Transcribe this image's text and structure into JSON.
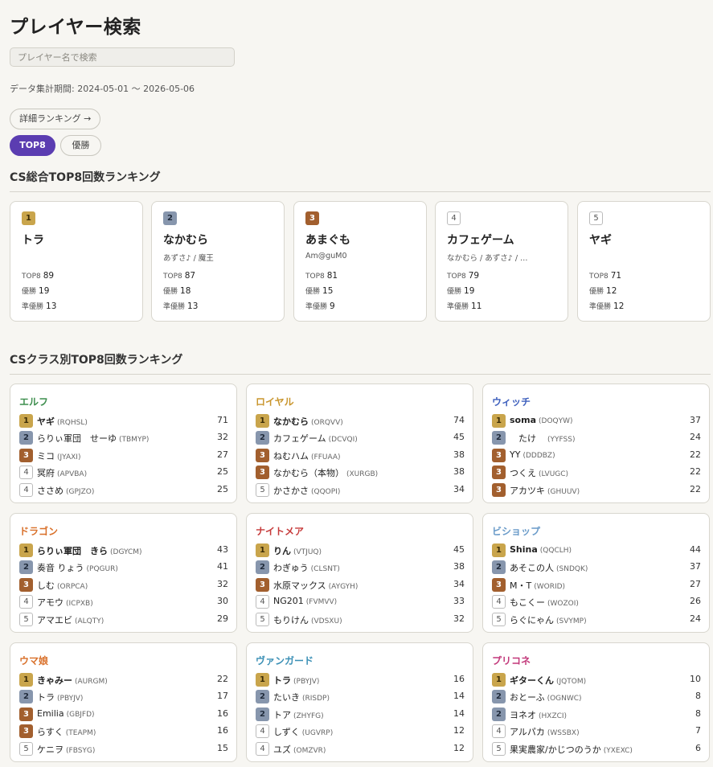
{
  "page": {
    "title": "プレイヤー検索",
    "search_placeholder": "プレイヤー名で検索",
    "period": "データ集計期間: 2024-05-01 〜 2026-05-06",
    "detail_button": "詳細ランキング →",
    "tabs": [
      "TOP8",
      "優勝"
    ]
  },
  "overall": {
    "title": "CS総合TOP8回数ランキング",
    "labels": {
      "top8": "TOP8",
      "win": "優勝",
      "runner": "準優勝"
    },
    "cards": [
      {
        "rank": "1",
        "name": "トラ",
        "sub": "",
        "top8": "89",
        "win": "19",
        "runner": "13"
      },
      {
        "rank": "2",
        "name": "なかむら",
        "sub": "あずさ♪ / 魔王",
        "top8": "87",
        "win": "18",
        "runner": "13"
      },
      {
        "rank": "3",
        "name": "あまぐも",
        "sub": "Am@guM0",
        "top8": "81",
        "win": "15",
        "runner": "9"
      },
      {
        "rank": "4",
        "name": "カフェゲーム",
        "sub": "なかむら / あずさ♪ / …",
        "top8": "79",
        "win": "19",
        "runner": "11"
      },
      {
        "rank": "5",
        "name": "ヤギ",
        "sub": "",
        "top8": "71",
        "win": "12",
        "runner": "12"
      }
    ]
  },
  "classes": {
    "title": "CSクラス別TOP8回数ランキング",
    "cards": [
      {
        "name": "エルフ",
        "color": "#3f8f4f",
        "rows": [
          {
            "rank": "1",
            "name": "ヤギ",
            "id": "(RQHSL)",
            "count": "71"
          },
          {
            "rank": "2",
            "name": "らりぃ軍団　せーゆ",
            "id": "(TBMYP)",
            "count": "32"
          },
          {
            "rank": "3",
            "name": "ミコ",
            "id": "(JYAXI)",
            "count": "27"
          },
          {
            "rank": "4",
            "name": "冥府",
            "id": "(APVBA)",
            "count": "25"
          },
          {
            "rank": "4",
            "name": "ささめ",
            "id": "(GPJZO)",
            "count": "25"
          }
        ]
      },
      {
        "name": "ロイヤル",
        "color": "#c9962e",
        "rows": [
          {
            "rank": "1",
            "name": "なかむら",
            "id": "(ORQVV)",
            "count": "74"
          },
          {
            "rank": "2",
            "name": "カフェゲーム",
            "id": "(DCVQI)",
            "count": "45"
          },
          {
            "rank": "3",
            "name": "ねむハム",
            "id": "(FFUAA)",
            "count": "38"
          },
          {
            "rank": "3",
            "name": "なかむら（本物）",
            "id": "(XURGB)",
            "count": "38"
          },
          {
            "rank": "5",
            "name": "かさかさ",
            "id": "(QQOPI)",
            "count": "34"
          }
        ]
      },
      {
        "name": "ウィッチ",
        "color": "#3d5fbd",
        "rows": [
          {
            "rank": "1",
            "name": "soma",
            "id": "(DOQYW)",
            "count": "37"
          },
          {
            "rank": "2",
            "name": "　たけ　",
            "id": "(YYFSS)",
            "count": "24"
          },
          {
            "rank": "3",
            "name": "YY",
            "id": "(DDDBZ)",
            "count": "22"
          },
          {
            "rank": "3",
            "name": "つくえ",
            "id": "(LVUGC)",
            "count": "22"
          },
          {
            "rank": "3",
            "name": "アカツキ",
            "id": "(GHUUV)",
            "count": "22"
          }
        ]
      },
      {
        "name": "ドラゴン",
        "color": "#d9702a",
        "rows": [
          {
            "rank": "1",
            "name": "らりぃ軍団　きら",
            "id": "(DGYCM)",
            "count": "43"
          },
          {
            "rank": "2",
            "name": "奏音 りょう",
            "id": "(PQGUR)",
            "count": "41"
          },
          {
            "rank": "3",
            "name": "しむ",
            "id": "(ORPCA)",
            "count": "32"
          },
          {
            "rank": "4",
            "name": "アモウ",
            "id": "(ICPXB)",
            "count": "30"
          },
          {
            "rank": "5",
            "name": "アマエビ",
            "id": "(ALQTY)",
            "count": "29"
          }
        ]
      },
      {
        "name": "ナイトメア",
        "color": "#c63a3a",
        "rows": [
          {
            "rank": "1",
            "name": "りん",
            "id": "(VTJUQ)",
            "count": "45"
          },
          {
            "rank": "2",
            "name": "わぎゅう",
            "id": "(CLSNT)",
            "count": "38"
          },
          {
            "rank": "3",
            "name": "水原マックス",
            "id": "(AYGYH)",
            "count": "34"
          },
          {
            "rank": "4",
            "name": "NG201",
            "id": "(FVMVV)",
            "count": "33"
          },
          {
            "rank": "5",
            "name": "もりけん",
            "id": "(VDSXU)",
            "count": "32"
          }
        ]
      },
      {
        "name": "ビショップ",
        "color": "#6a9bc9",
        "rows": [
          {
            "rank": "1",
            "name": "Shina",
            "id": "(QQCLH)",
            "count": "44"
          },
          {
            "rank": "2",
            "name": "あそこの人",
            "id": "(SNDQK)",
            "count": "37"
          },
          {
            "rank": "3",
            "name": "M・T",
            "id": "(WORID)",
            "count": "27"
          },
          {
            "rank": "4",
            "name": "もこくー",
            "id": "(WOZOI)",
            "count": "26"
          },
          {
            "rank": "5",
            "name": "らぐにゃん",
            "id": "(SVYMP)",
            "count": "24"
          }
        ]
      },
      {
        "name": "ウマ娘",
        "color": "#d9702a",
        "rows": [
          {
            "rank": "1",
            "name": "きゃみー",
            "id": "(AURGM)",
            "count": "22"
          },
          {
            "rank": "2",
            "name": "トラ",
            "id": "(PBYJV)",
            "count": "17"
          },
          {
            "rank": "3",
            "name": "Emilia",
            "id": "(GBJFD)",
            "count": "16"
          },
          {
            "rank": "3",
            "name": "らすく",
            "id": "(TEAPM)",
            "count": "16"
          },
          {
            "rank": "5",
            "name": "ケニヲ",
            "id": "(FBSYG)",
            "count": "15"
          }
        ]
      },
      {
        "name": "ヴァンガード",
        "color": "#3a8fb5",
        "rows": [
          {
            "rank": "1",
            "name": "トラ",
            "id": "(PBYJV)",
            "count": "16"
          },
          {
            "rank": "2",
            "name": "たいき",
            "id": "(RISDP)",
            "count": "14"
          },
          {
            "rank": "2",
            "name": "トア",
            "id": "(ZHYFG)",
            "count": "14"
          },
          {
            "rank": "4",
            "name": "しずく",
            "id": "(UGVRP)",
            "count": "12"
          },
          {
            "rank": "4",
            "name": "ユズ",
            "id": "(OMZVR)",
            "count": "12"
          }
        ]
      },
      {
        "name": "プリコネ",
        "color": "#c2387a",
        "rows": [
          {
            "rank": "1",
            "name": "ギターくん",
            "id": "(JQTOM)",
            "count": "10"
          },
          {
            "rank": "2",
            "name": "おとーふ",
            "id": "(OGNWC)",
            "count": "8"
          },
          {
            "rank": "2",
            "name": "ヨネオ",
            "id": "(HXZCI)",
            "count": "8"
          },
          {
            "rank": "4",
            "name": "アルパカ",
            "id": "(WSSBX)",
            "count": "7"
          },
          {
            "rank": "5",
            "name": "果実農家/かじつのうか",
            "id": "(YXEXC)",
            "count": "6"
          }
        ]
      }
    ]
  }
}
